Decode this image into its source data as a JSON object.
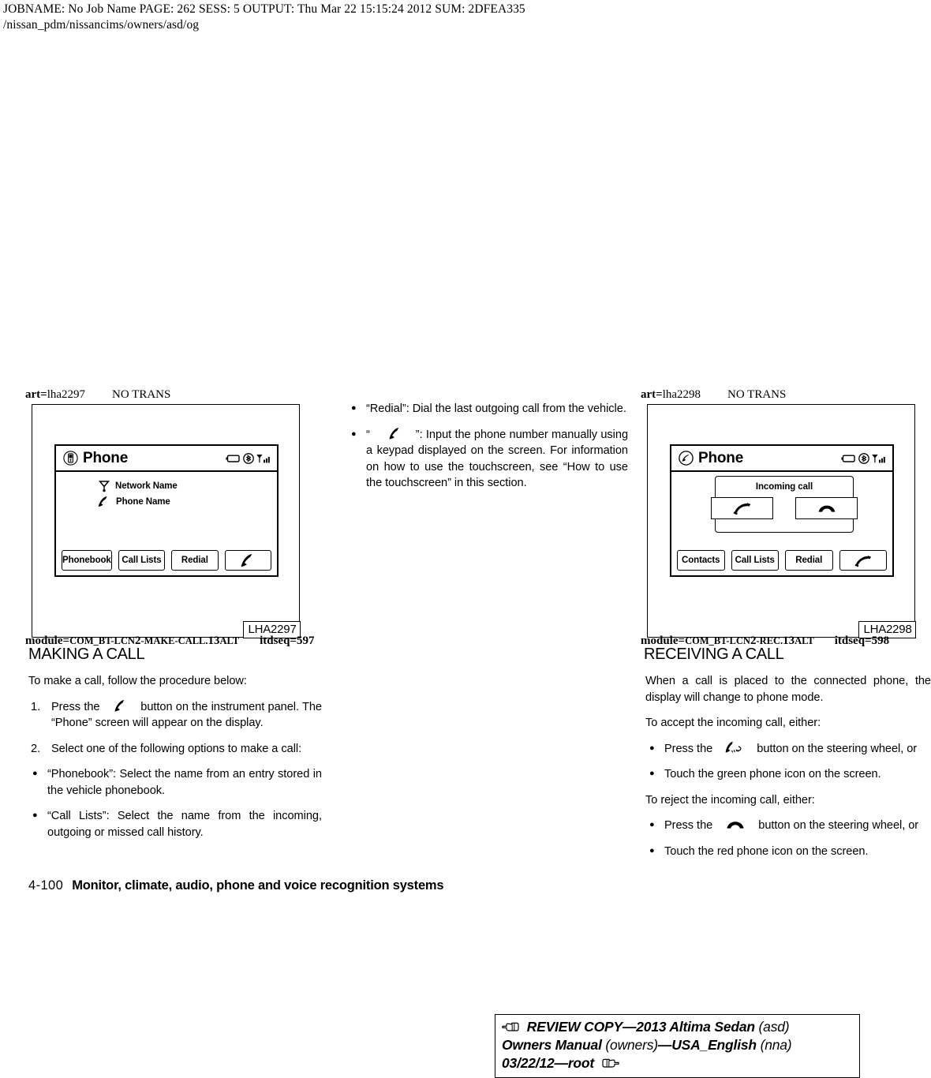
{
  "job_header": {
    "line1": "JOBNAME: No Job Name   PAGE: 262   SESS: 5   OUTPUT: Thu Mar 22 15:15:24 2012   SUM: 2DFEA335",
    "line2": "/nissan_pdm/nissancims/owners/asd/og"
  },
  "left_figure": {
    "art_prefix": "art=",
    "art_id": "lha2297",
    "art_trans": "NO TRANS",
    "caption": "LHA2297",
    "module_prefix": "module=",
    "module_name_sc": "COM_BT-LCN",
    "module_num": "2",
    "module_mid_sc": "-MAKE-CALL.",
    "module_rev": "13",
    "module_alt_sc": "ALT",
    "module_seq": "itdseq=597",
    "screen": {
      "title": "Phone",
      "title_icon": "mobile-phone-circle-icon",
      "status_icons": [
        "battery-icon",
        "bluetooth-icon",
        "signal-bars-icon"
      ],
      "rows": [
        {
          "icon": "antenna-icon",
          "label": "Network Name"
        },
        {
          "icon": "handset-icon",
          "label": "Phone Name"
        }
      ],
      "softkeys": [
        "Phonebook",
        "Call Lists",
        "Redial"
      ],
      "softkey_icon": "handset-icon"
    }
  },
  "right_figure": {
    "art_prefix": "art=",
    "art_id": "lha2298",
    "art_trans": "NO TRANS",
    "caption": "LHA2298",
    "module_prefix": "module=",
    "module_name_sc": "COM_BT-LCN",
    "module_num": "2",
    "module_mid_sc": "-REC.",
    "module_rev": "13",
    "module_alt_sc": "ALT",
    "module_seq": "itdseq=598",
    "screen": {
      "title": "Phone",
      "title_icon": "handset-circle-icon",
      "status_icons": [
        "battery-icon",
        "bluetooth-icon",
        "signal-bars-icon"
      ],
      "incoming_title": "Incoming call",
      "accept_icon": "accept-call-icon",
      "reject_icon": "reject-call-icon",
      "softkeys": [
        "Contacts",
        "Call Lists",
        "Redial"
      ],
      "softkey_icon": "accept-call-icon"
    }
  },
  "middle_column": {
    "bullets": [
      "“Redial”: Dial the last outgoing call from the vehicle.",
      "”: Input the phone number manually using a keypad displayed on the screen. For information on how to use the touchscreen, see “How to use the touchscreen” in this section."
    ],
    "bullet2_open_quote": "“"
  },
  "left_column": {
    "heading": "MAKING A CALL",
    "intro": "To make a call, follow the procedure below:",
    "steps": [
      {
        "num": "1.",
        "text_before": "Press  the",
        "icon": "handset-icon",
        "text_after": "button  on  the  instrument panel. The “Phone” screen will appear on the display."
      },
      {
        "num": "2.",
        "text": "Select one of the following options to make a call:"
      }
    ],
    "bullets": [
      "“Phonebook”: Select the name from an entry stored in the vehicle phonebook.",
      "“Call Lists”: Select the name from the incoming, outgoing or missed call history."
    ]
  },
  "right_column": {
    "heading": "RECEIVING A CALL",
    "intro": "When a call is placed to the connected phone, the display will change to phone mode.",
    "accept_lead": "To accept the incoming call, either:",
    "accept_bullets": [
      {
        "text_before": "Press  the",
        "icon": "steering-accept-icon",
        "text_after": "button  on  the  steering wheel, or"
      },
      {
        "text": "Touch the green phone icon on the screen."
      }
    ],
    "reject_lead": "To reject the incoming call, either:",
    "reject_bullets": [
      {
        "text_before": "Press  the",
        "icon": "reject-call-icon",
        "text_after": "button  on  the  steering wheel, or"
      },
      {
        "text": "Touch the red phone icon on the screen."
      }
    ]
  },
  "page_footer": {
    "folio": "4-100",
    "title": "Monitor, climate, audio, phone and voice recognition systems"
  },
  "review_box": {
    "line1_bold": "REVIEW COPY—2013 Altima Sedan",
    "line1_reg": "(asd)",
    "line2_bold_a": "Owners Manual",
    "line2_reg_a": "(owners)",
    "line2_bold_b": "—USA_English",
    "line2_reg_b": "(nna)",
    "line3": "03/22/12—root",
    "icon_start": "pointing-hand-right-icon",
    "icon_end": "pointing-hand-left-icon"
  }
}
